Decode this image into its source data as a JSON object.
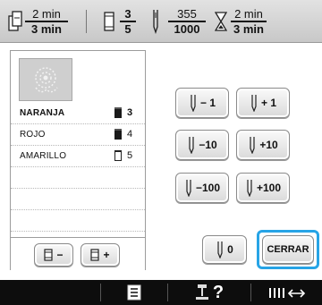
{
  "status_bar": {
    "time_current": "2 min",
    "time_total": "3 min",
    "color_current": "3",
    "color_total": "5",
    "stitch_current": "355",
    "stitch_total": "1000",
    "remaining_current": "2 min",
    "remaining_total": "3 min"
  },
  "thread_list": [
    {
      "name": "NARANJA",
      "number": "3",
      "selected": true
    },
    {
      "name": "ROJO",
      "number": "4",
      "selected": false
    },
    {
      "name": "AMARILLO",
      "number": "5",
      "selected": false
    }
  ],
  "spool_buttons": {
    "minus": "−",
    "plus": "+"
  },
  "stitch_buttons": {
    "minus1": "− 1",
    "plus1": "+ 1",
    "minus10": "−10",
    "plus10": "+10",
    "minus100": "−100",
    "plus100": "+100",
    "zero": "0"
  },
  "close_button": "CERRAR",
  "bottom_bar": {
    "help_label": "?"
  },
  "colors": {
    "highlight": "#27a4e6",
    "bottom_bar": "#0d0d0d"
  }
}
